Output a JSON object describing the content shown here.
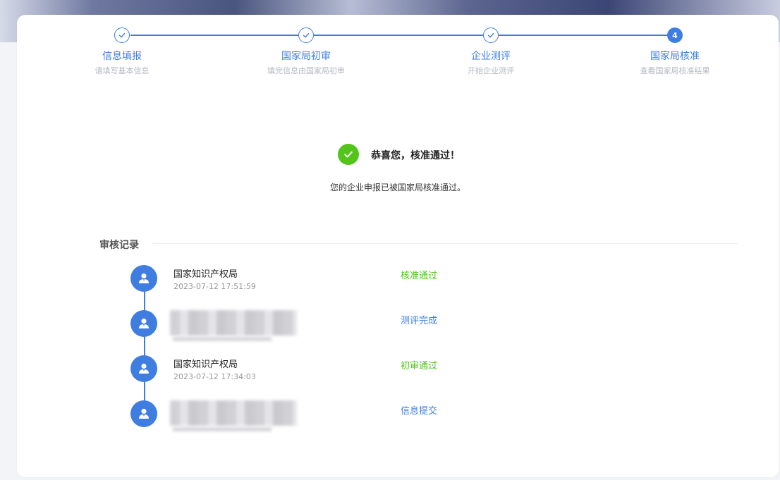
{
  "steps": [
    {
      "title": "信息填报",
      "desc": "请填写基本信息",
      "state": "done"
    },
    {
      "title": "国家局初审",
      "desc": "填完信息由国家局初审",
      "state": "done"
    },
    {
      "title": "企业测评",
      "desc": "开始企业测评",
      "state": "done"
    },
    {
      "title": "国家局核准",
      "desc": "查看国家局核准结果",
      "state": "current",
      "number": "4"
    }
  ],
  "result": {
    "title": "恭喜您，核准通过！",
    "subtitle": "您的企业申报已被国家局核准通过。"
  },
  "records": {
    "title": "审核记录",
    "items": [
      {
        "org": "国家知识产权局",
        "time": "2023-07-12 17:51:59",
        "status": "核准通过",
        "status_color": "#52c41a"
      },
      {
        "org": "",
        "time": "",
        "status": "测评完成",
        "status_color": "#3d7fe0",
        "redacted": true
      },
      {
        "org": "国家知识产权局",
        "time": "2023-07-12 17:34:03",
        "status": "初审通过",
        "status_color": "#52c41a"
      },
      {
        "org": "",
        "time": "",
        "status": "信息提交",
        "status_color": "#3d7fe0",
        "redacted": true
      }
    ]
  },
  "colors": {
    "accent": "#3d7fe0",
    "success": "#52c41a"
  }
}
